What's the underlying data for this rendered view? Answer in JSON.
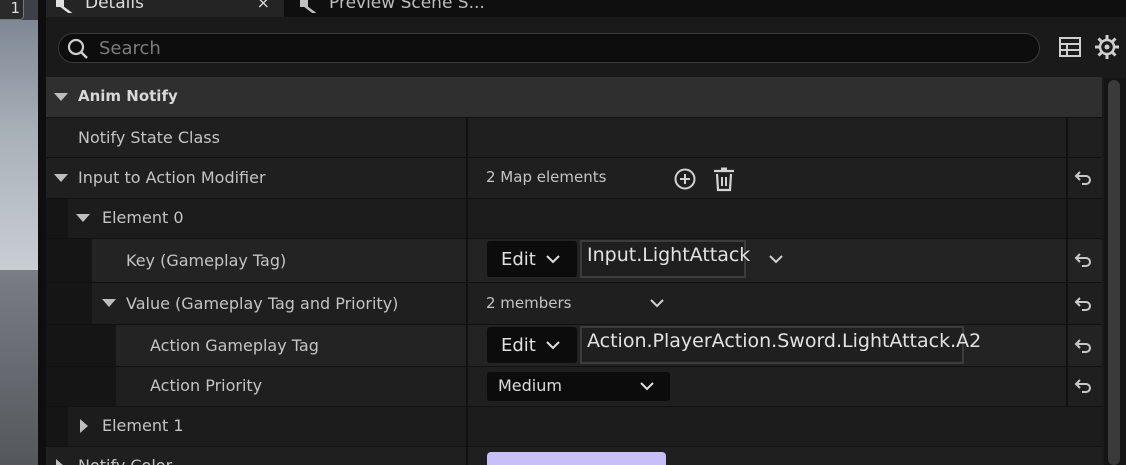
{
  "viewport": {
    "badge": "1"
  },
  "tabs": [
    {
      "label": "Details",
      "close": "×"
    },
    {
      "label": "Preview Scene S..."
    }
  ],
  "search": {
    "placeholder": "Search"
  },
  "section": {
    "title": "Anim Notify"
  },
  "rows": {
    "notify_state_class": {
      "label": "Notify State Class"
    },
    "input_to_action_modifier": {
      "label": "Input to Action Modifier",
      "value": "2 Map elements"
    },
    "element_0": {
      "label": "Element 0"
    },
    "key": {
      "label": "Key (Gameplay Tag)",
      "edit": "Edit",
      "tag": "Input.LightAttack"
    },
    "value": {
      "label": "Value (Gameplay Tag and Priority)",
      "value": "2 members"
    },
    "action_gameplay_tag": {
      "label": "Action Gameplay Tag",
      "edit": "Edit",
      "tag": "Action.PlayerAction.Sword.LightAttack.A2"
    },
    "action_priority": {
      "label": "Action Priority",
      "value": "Medium"
    },
    "element_1": {
      "label": "Element 1"
    },
    "notify_color": {
      "label": "Notify Color",
      "swatch": "#c8bff7"
    }
  },
  "colors": {
    "row_dark": "#1c1c1c",
    "row_light": "#242424",
    "header": "#2f2f2f",
    "accent_swatch": "#c8bff7"
  }
}
